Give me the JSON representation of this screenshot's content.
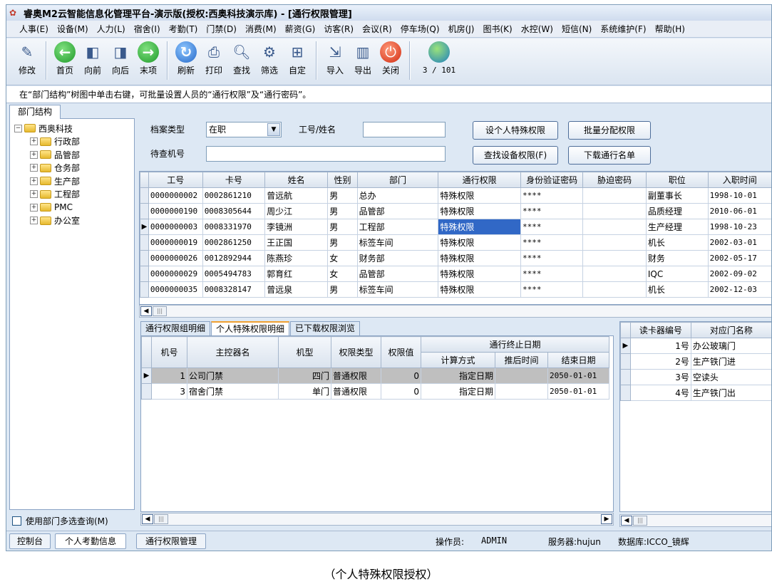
{
  "window": {
    "title": "睿奥M2云智能信息化管理平台-演示版(授权:西奥科技演示库) - [通行权限管理]"
  },
  "menu": [
    "人事(E)",
    "设备(M)",
    "人力(L)",
    "宿舍(I)",
    "考勤(T)",
    "门禁(D)",
    "消费(M)",
    "薪资(G)",
    "访客(R)",
    "会议(R)",
    "停车场(Q)",
    "机房(J)",
    "图书(K)",
    "水控(W)",
    "短信(N)",
    "系统维护(F)",
    "帮助(H)"
  ],
  "toolbar": {
    "edit": "修改",
    "first": "首页",
    "prev": "向前",
    "next": "向后",
    "last": "末项",
    "refresh": "刷新",
    "print": "打印",
    "find": "查找",
    "filter": "筛选",
    "custom": "自定",
    "import": "导入",
    "export": "导出",
    "close": "关闭",
    "record_counter": "3 / 101"
  },
  "hint": "在“部门结构”树图中单击右键，可批量设置人员的“通行权限”及“通行密码”。",
  "left": {
    "tab": "部门结构",
    "root": "西奥科技",
    "nodes": [
      "行政部",
      "品管部",
      "仓务部",
      "生产部",
      "工程部",
      "PMC",
      "办公室"
    ],
    "multi_select": "使用部门多选查询(M)"
  },
  "filters": {
    "archive_type_label": "档案类型",
    "archive_type_value": "在职",
    "emp_label": "工号/姓名",
    "emp_value": "",
    "machine_label": "待查机号",
    "machine_value": "",
    "btn_personal": "设个人特殊权限",
    "btn_batch": "批量分配权限",
    "btn_find_device": "查找设备权限(F)",
    "btn_download": "下载通行名单"
  },
  "people": {
    "headers": [
      "工号",
      "卡号",
      "姓名",
      "性别",
      "部门",
      "通行权限",
      "身份验证密码",
      "胁迫密码",
      "职位",
      "入职时间"
    ],
    "rows": [
      [
        "0000000002",
        "0002861210",
        "曾远航",
        "男",
        "总办",
        "特殊权限",
        "****",
        "",
        "副董事长",
        "1998-10-01"
      ],
      [
        "0000000190",
        "0008305644",
        "周少江",
        "男",
        "品管部",
        "特殊权限",
        "****",
        "",
        "品质经理",
        "2010-06-01"
      ],
      [
        "0000000003",
        "0008331970",
        "李镜洲",
        "男",
        "工程部",
        "特殊权限",
        "****",
        "",
        "生产经理",
        "1998-10-23"
      ],
      [
        "0000000019",
        "0002861250",
        "王正国",
        "男",
        "标签车间",
        "特殊权限",
        "****",
        "",
        "机长",
        "2002-03-01"
      ],
      [
        "0000000026",
        "0012892944",
        "陈燕珍",
        "女",
        "财务部",
        "特殊权限",
        "****",
        "",
        "财务",
        "2002-05-17"
      ],
      [
        "0000000029",
        "0005494783",
        "郭育红",
        "女",
        "品管部",
        "特殊权限",
        "****",
        "",
        "IQC",
        "2002-09-02"
      ],
      [
        "0000000035",
        "0008328147",
        "曾远泉",
        "男",
        "标签车间",
        "特殊权限",
        "****",
        "",
        "机长",
        "2002-12-03"
      ]
    ]
  },
  "bottom_tabs": [
    "通行权限组明细",
    "个人特殊权限明细",
    "已下载权限浏览"
  ],
  "perms": {
    "headers": {
      "machine": "机号",
      "controller": "主控器名",
      "model": "机型",
      "perm_type": "权限类型",
      "perm_value": "权限值",
      "end_group": "通行终止日期",
      "calc": "计算方式",
      "delay": "推后时间",
      "end_date": "结束日期"
    },
    "rows": [
      [
        "1",
        "公司门禁",
        "四门",
        "普通权限",
        "0",
        "指定日期",
        "",
        "2050-01-01"
      ],
      [
        "3",
        "宿舍门禁",
        "单门",
        "普通权限",
        "0",
        "指定日期",
        "",
        "2050-01-01"
      ]
    ]
  },
  "readers": {
    "headers": [
      "读卡器编号",
      "对应门名称"
    ],
    "rows": [
      [
        "1号",
        "办公玻璃门"
      ],
      [
        "2号",
        "生产铁门进"
      ],
      [
        "3号",
        "空读头"
      ],
      [
        "4号",
        "生产铁门出"
      ]
    ]
  },
  "status": {
    "tab_console": "控制台",
    "tab_attendance": "个人考勤信息",
    "tab_access": "通行权限管理",
    "operator_label": "操作员:",
    "operator_value": "ADMIN",
    "server": "服务器:hujun",
    "database": "数据库:ICCO_镜辉"
  },
  "caption": "（个人特殊权限授权）"
}
